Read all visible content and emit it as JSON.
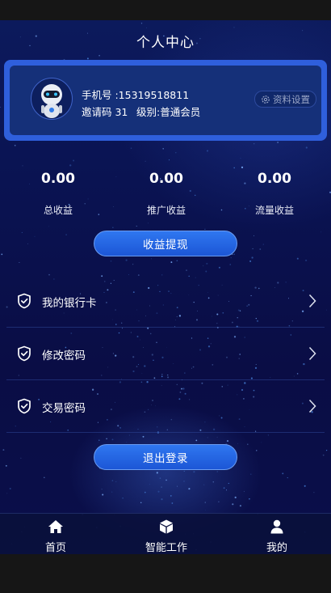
{
  "header": {
    "title": "个人中心"
  },
  "profile": {
    "phone": "手机号 :15319518811",
    "invite": "邀请码 31",
    "level": "级别:普通会员",
    "settings_label": "资料设置"
  },
  "stats": [
    {
      "value": "0.00",
      "label": "总收益"
    },
    {
      "value": "0.00",
      "label": "推广收益"
    },
    {
      "value": "0.00",
      "label": "流量收益"
    }
  ],
  "withdraw_label": "收益提现",
  "menu": [
    {
      "label": "我的银行卡",
      "icon": "shield-check-icon"
    },
    {
      "label": "修改密码",
      "icon": "shield-check-icon"
    },
    {
      "label": "交易密码",
      "icon": "shield-check-icon"
    }
  ],
  "logout_label": "退出登录",
  "tabs": [
    {
      "label": "首页",
      "icon": "home-icon"
    },
    {
      "label": "智能工作",
      "icon": "cube-icon"
    },
    {
      "label": "我的",
      "icon": "user-icon"
    }
  ],
  "colors": {
    "accent": "#2f5fdc",
    "button": "#1c56d6",
    "background": "#0a1352"
  }
}
